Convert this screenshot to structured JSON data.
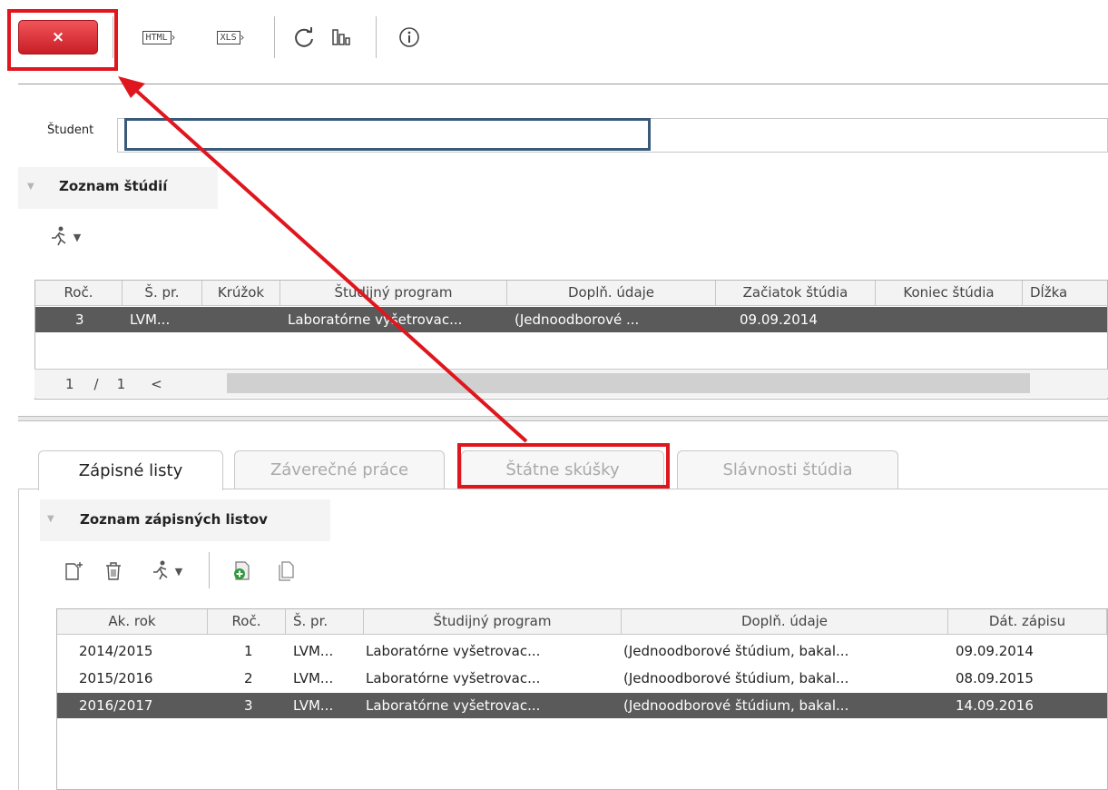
{
  "toolbar": {
    "close_label": "×",
    "html_label": "HTML",
    "xls_label": "XLS",
    "refresh_icon": "refresh-icon",
    "structure_icon": "structure-icon",
    "info_icon": "info-icon"
  },
  "student": {
    "label": "Študent",
    "value": ""
  },
  "studies": {
    "title": "Zoznam štúdií",
    "columns": [
      "Roč.",
      "Š. pr.",
      "Krúžok",
      "Študijný program",
      "Doplň. údaje",
      "Začiatok štúdia",
      "Koniec štúdia",
      "Dĺžka"
    ],
    "rows": [
      [
        "3",
        "LVM...",
        "",
        "Laboratórne vyšetrovac...",
        "(Jednoodborové ...",
        "09.09.2014",
        "",
        ""
      ]
    ],
    "pager": {
      "current": "1",
      "separator": "/",
      "total": "1",
      "prev": "<"
    }
  },
  "tabs": [
    {
      "label": "Zápisné listy",
      "active": true
    },
    {
      "label": "Záverečné práce",
      "active": false
    },
    {
      "label": "Štátne skúšky",
      "active": false
    },
    {
      "label": "Slávnosti štúdia",
      "active": false
    }
  ],
  "enrollment": {
    "title": "Zoznam zápisných listov",
    "columns": [
      "Ak. rok",
      "Roč.",
      "Š. pr.",
      "Študijný program",
      "Doplň. údaje",
      "Dát. zápisu"
    ],
    "rows": [
      [
        "2014/2015",
        "1",
        "LVM...",
        "Laboratórne vyšetrovac...",
        "(Jednoodborové štúdium, bakal...",
        "09.09.2014"
      ],
      [
        "2015/2016",
        "2",
        "LVM...",
        "Laboratórne vyšetrovac...",
        "(Jednoodborové štúdium, bakal...",
        "08.09.2015"
      ],
      [
        "2016/2017",
        "3",
        "LVM...",
        "Laboratórne vyšetrovac...",
        "(Jednoodborové štúdium, bakal...",
        "14.09.2016"
      ]
    ]
  },
  "colors": {
    "annotation_red": "#e0161e",
    "highlight_blue": "#3a5a7a",
    "selected_row": "#5a5a5a"
  }
}
